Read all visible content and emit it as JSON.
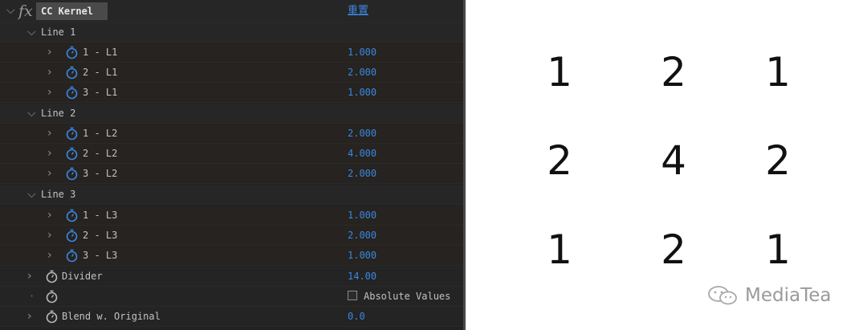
{
  "effect": {
    "name": "CC Kernel",
    "reset_label": "重置"
  },
  "groups": [
    {
      "label": "Line 1",
      "params": [
        {
          "label": "1 - L1",
          "value": "1.000"
        },
        {
          "label": "2 - L1",
          "value": "2.000"
        },
        {
          "label": "3 - L1",
          "value": "1.000"
        }
      ]
    },
    {
      "label": "Line 2",
      "params": [
        {
          "label": "1 - L2",
          "value": "2.000"
        },
        {
          "label": "2 - L2",
          "value": "4.000"
        },
        {
          "label": "3 - L2",
          "value": "2.000"
        }
      ]
    },
    {
      "label": "Line 3",
      "params": [
        {
          "label": "1 - L3",
          "value": "1.000"
        },
        {
          "label": "2 - L3",
          "value": "2.000"
        },
        {
          "label": "3 - L3",
          "value": "1.000"
        }
      ]
    }
  ],
  "divider": {
    "label": "Divider",
    "value": "14.00"
  },
  "absolute_values": {
    "label": "Absolute Values",
    "checked": false
  },
  "blend": {
    "label": "Blend w. Original",
    "value": "0.0"
  },
  "kernel_grid": [
    [
      "1",
      "2",
      "1"
    ],
    [
      "2",
      "4",
      "2"
    ],
    [
      "1",
      "2",
      "1"
    ]
  ],
  "watermark": "MediaTea",
  "colors": {
    "value_blue": "#3b87e0",
    "stopwatch_blue": "#3b87e0",
    "panel_bg": "#222222"
  },
  "icons": {
    "expand": "chevron-down-icon",
    "collapsed": "chevron-right-icon",
    "keyframe": "stopwatch-icon",
    "effect": "fx-icon"
  }
}
